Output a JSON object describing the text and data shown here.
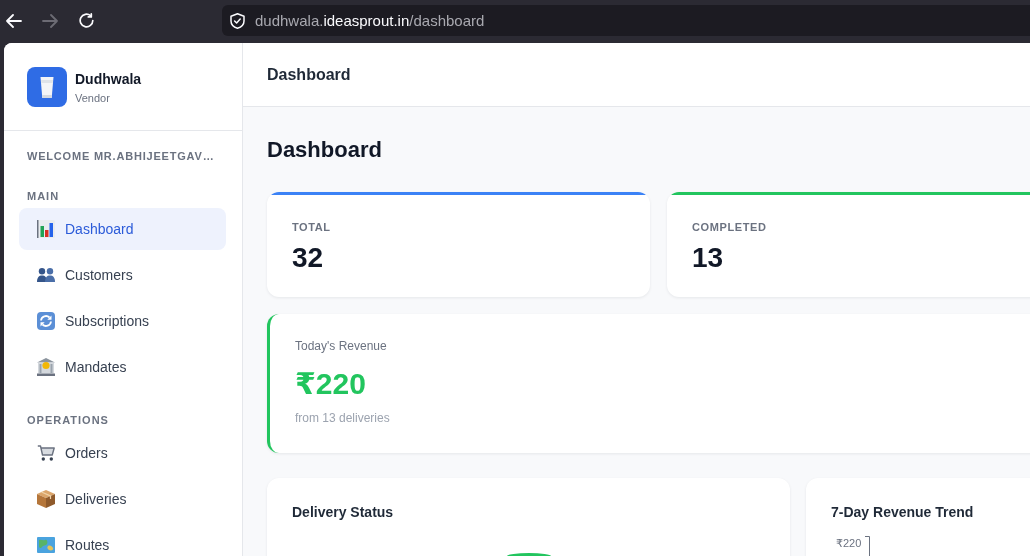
{
  "browser": {
    "nav_buttons": [
      {
        "kind": "back",
        "disabled": false
      },
      {
        "kind": "forward",
        "disabled": true
      },
      {
        "kind": "reload",
        "disabled": false
      }
    ],
    "url": {
      "subdomain": "dudhwala.",
      "domain": "ideasprout.in",
      "path": "/dashboard"
    }
  },
  "sidebar": {
    "brand": {
      "name": "Dudhwala",
      "role": "Vendor"
    },
    "welcome": "WELCOME MR.ABHIJEETGAV…",
    "sections": [
      {
        "title": "MAIN",
        "items": [
          {
            "label": "Dashboard",
            "selected": true
          },
          {
            "label": "Customers",
            "selected": false
          },
          {
            "label": "Subscriptions",
            "selected": false
          },
          {
            "label": "Mandates",
            "selected": false
          }
        ]
      },
      {
        "title": "OPERATIONS",
        "items": [
          {
            "label": "Orders",
            "selected": false
          },
          {
            "label": "Deliveries",
            "selected": false
          },
          {
            "label": "Routes",
            "selected": false
          }
        ]
      }
    ]
  },
  "header": {
    "title": "Dashboard"
  },
  "page": {
    "title": "Dashboard",
    "stats": [
      {
        "label": "TOTAL",
        "value": "32",
        "color": "#3b82f6"
      },
      {
        "label": "COMPLETED",
        "value": "13",
        "color": "#22c55e"
      }
    ],
    "revenue": {
      "label": "Today's Revenue",
      "value": "₹220",
      "note": "from 13 deliveries"
    },
    "panels": [
      {
        "kind": "donut",
        "title": "Delivery Status"
      },
      {
        "kind": "trend",
        "title": "7-Day Revenue Trend",
        "y_tick": "₹220"
      }
    ]
  }
}
